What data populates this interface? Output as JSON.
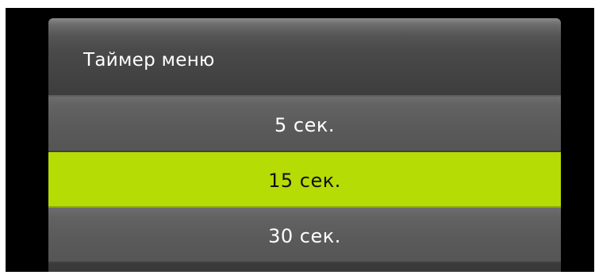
{
  "menu": {
    "title": "Таймер меню",
    "options": [
      {
        "label": "5 сек.",
        "selected": false
      },
      {
        "label": "15 сек.",
        "selected": true
      },
      {
        "label": "30 сек.",
        "selected": false
      }
    ],
    "colors": {
      "highlight": "#b5dc05",
      "background": "#000000",
      "item": "#5c5c5c"
    }
  }
}
